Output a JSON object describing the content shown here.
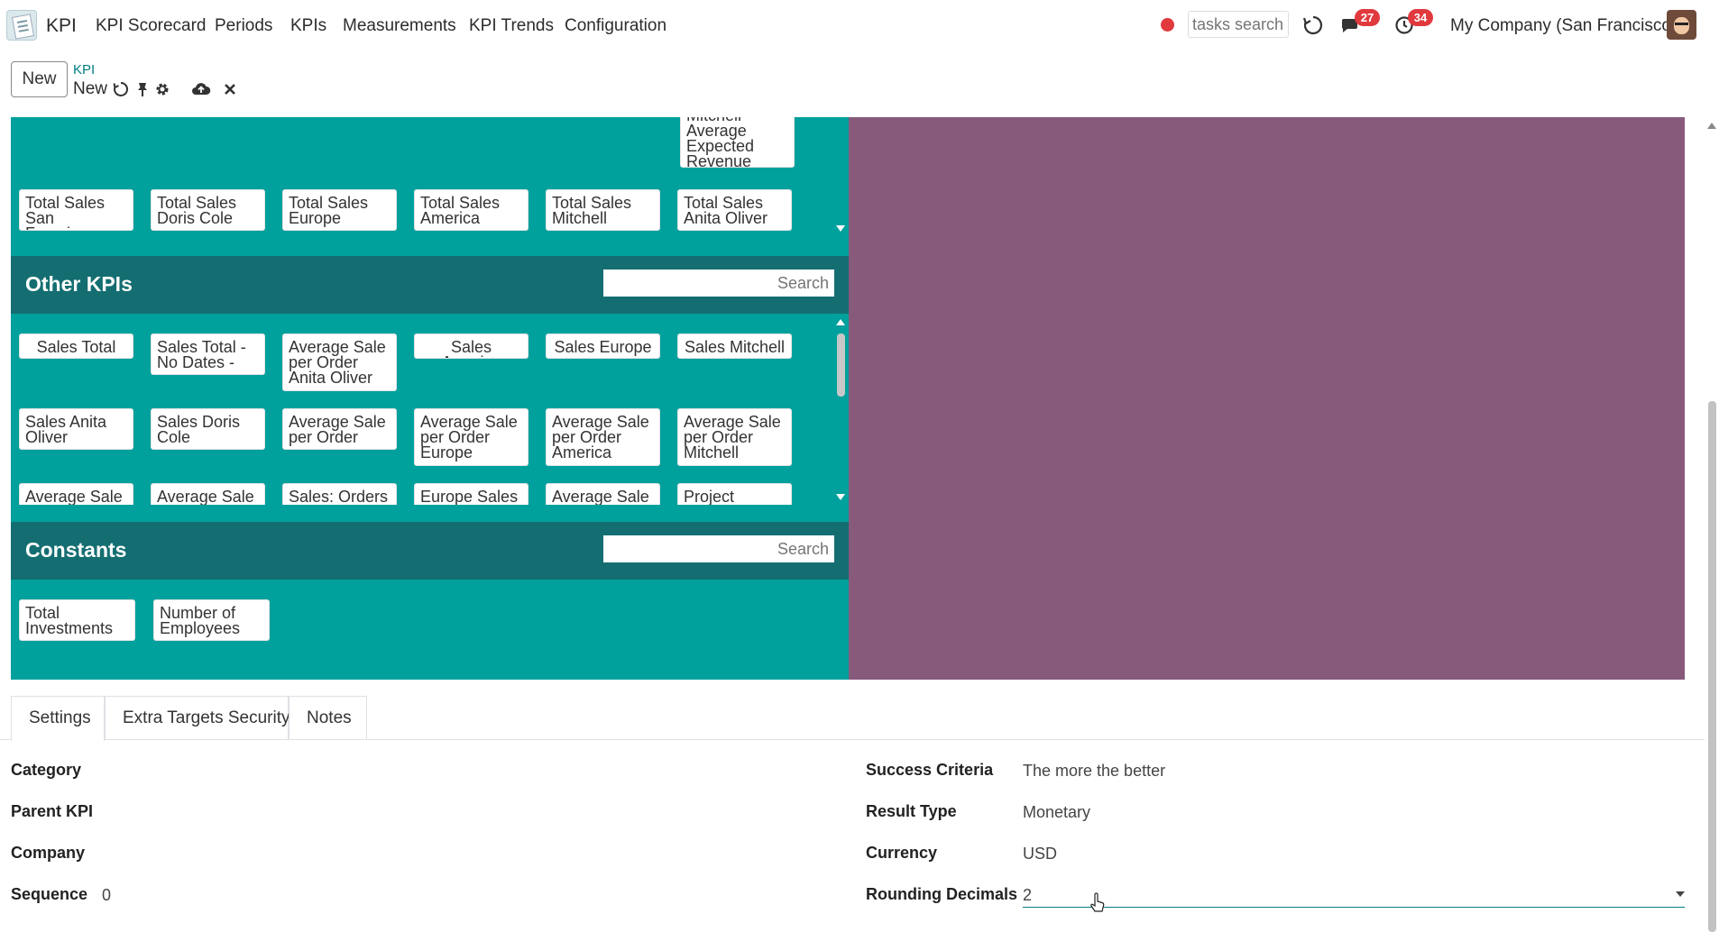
{
  "navbar": {
    "brand": "KPI",
    "menu": [
      "KPI Scorecard",
      "Periods",
      "KPIs",
      "Measurements",
      "KPI Trends",
      "Configuration"
    ],
    "search_placeholder": "tasks search",
    "messages_count": "27",
    "activities_count": "34",
    "company": "My Company (San Francisco)"
  },
  "control_panel": {
    "new_label": "New",
    "breadcrumb_parent": "KPI",
    "breadcrumb_current": "New"
  },
  "kpi_sections": {
    "measurements_top_partial": [
      "Mitchell Average Expected Revenue"
    ],
    "measurements_row": [
      "Total Sales San Francisco",
      "Total Sales Doris Cole",
      "Total Sales Europe",
      "Total Sales America",
      "Total Sales Mitchell",
      "Total Sales Anita Oliver"
    ],
    "other_kpis": {
      "title": "Other KPIs",
      "search_placeholder": "Search",
      "row1": [
        "Sales Total",
        "Sales Total - No Dates -",
        "Average Sale per Order Anita Oliver",
        "Sales America",
        "Sales Europe",
        "Sales Mitchell"
      ],
      "row2": [
        "Sales Anita Oliver",
        "Sales Doris Cole",
        "Average Sale per Order",
        "Average Sale per Order Europe",
        "Average Sale per Order America",
        "Average Sale per Order Mitchell"
      ],
      "row3": [
        "Average Sale",
        "Average Sale",
        "Sales: Orders",
        "Europe Sales",
        "Average Sale",
        "Project"
      ]
    },
    "constants": {
      "title": "Constants",
      "search_placeholder": "Search",
      "items": [
        "Total Investments",
        "Number of Employees"
      ]
    }
  },
  "tabs": [
    "Settings",
    "Extra Targets Security",
    "Notes"
  ],
  "form": {
    "left": {
      "category_label": "Category",
      "parent_kpi_label": "Parent KPI",
      "company_label": "Company",
      "sequence_label": "Sequence",
      "sequence_value": "0"
    },
    "right": {
      "success_criteria_label": "Success Criteria",
      "success_criteria_value": "The more the better",
      "result_type_label": "Result Type",
      "result_type_value": "Monetary",
      "currency_label": "Currency",
      "currency_value": "USD",
      "rounding_decimals_label": "Rounding Decimals",
      "rounding_decimals_value": "2"
    }
  },
  "colors": {
    "teal": "#00a09d",
    "dark_teal": "#146e71",
    "purple": "#875a7b",
    "accent": "#017e84",
    "badge": "#e0393e"
  }
}
